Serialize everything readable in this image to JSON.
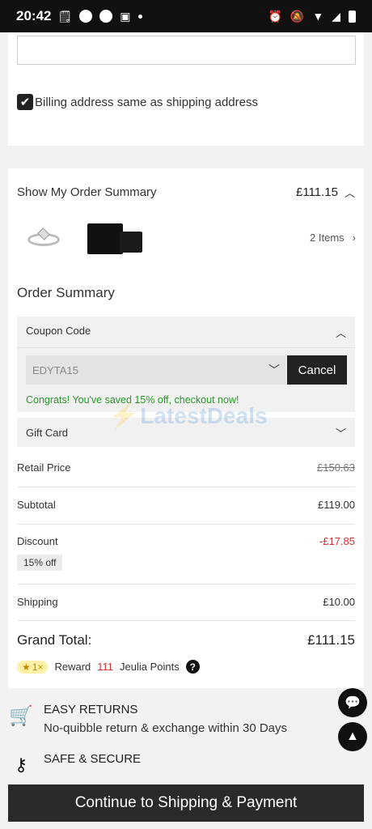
{
  "status_bar": {
    "time": "20:42"
  },
  "billing": {
    "checkbox_mark": "✔",
    "label": "Billing address same as shipping address"
  },
  "order_summary_toggle": {
    "title": "Show My Order Summary",
    "total": "£111.15",
    "items_label": "2 Items"
  },
  "order_summary": {
    "title": "Order Summary",
    "coupon": {
      "label": "Coupon Code",
      "code": "EDYTA15",
      "cancel_label": "Cancel",
      "message": "Congrats! You've saved 15% off, checkout now!"
    },
    "gift_card": {
      "label": "Gift Card"
    },
    "rows": {
      "retail_label": "Retail Price",
      "retail_value": "£150.63",
      "subtotal_label": "Subtotal",
      "subtotal_value": "£119.00",
      "discount_label": "Discount",
      "discount_value": "-£17.85",
      "discount_badge": "15% off",
      "shipping_label": "Shipping",
      "shipping_value": "£10.00"
    },
    "grand_total_label": "Grand Total:",
    "grand_total_value": "£111.15",
    "reward": {
      "multiplier": "1×",
      "prefix": "Reward",
      "points": "111",
      "suffix": "Jeulia Points",
      "help": "?"
    }
  },
  "watermark": {
    "text": "LatestDeals"
  },
  "features": {
    "returns_title": "EASY RETURNS",
    "returns_desc": "No-quibble return & exchange within 30 Days",
    "secure_title": "SAFE & SECURE"
  },
  "cta": {
    "label": "Continue to Shipping & Payment"
  },
  "colors": {
    "accent_dark": "#222222",
    "success_green": "#2a9a2a",
    "discount_red": "#d43030"
  },
  "icons": [
    "check-icon",
    "chevron-up-icon",
    "chevron-right-icon",
    "chevron-down-icon",
    "star-icon",
    "question-icon",
    "cart-icon",
    "key-icon",
    "chat-icon",
    "arrow-up-icon"
  ]
}
